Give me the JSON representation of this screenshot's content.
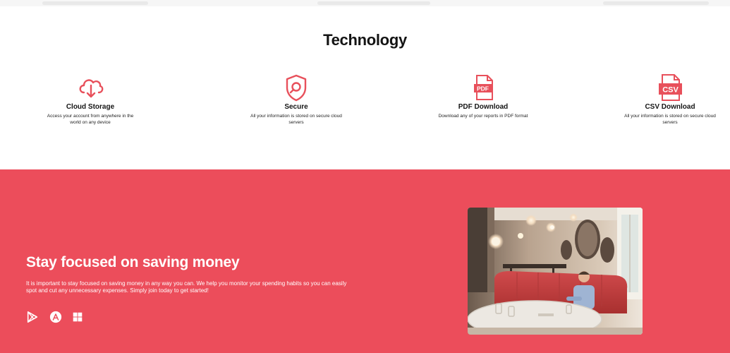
{
  "technology": {
    "title": "Technology",
    "features": [
      {
        "icon": "cloud-download-icon",
        "title": "Cloud Storage",
        "description": "Access your account from anywhere in the world on any device"
      },
      {
        "icon": "shield-lock-icon",
        "title": "Secure",
        "description": "All your information is stored on secure cloud servers"
      },
      {
        "icon": "pdf-file-icon",
        "title": "PDF Download",
        "description": "Download any of your reports in PDF format"
      },
      {
        "icon": "csv-file-icon",
        "title": "CSV Download",
        "description": "All your information is stored on secure cloud servers"
      }
    ]
  },
  "promo": {
    "heading": "Stay focused on saving money",
    "text": "It is important to stay focused on saving money in any way you can. We help you monitor your spending habits so you can easily spot and cut any unnecessary expenses. Simply join today to get started!",
    "store_icons": [
      "google-play-icon",
      "app-store-icon",
      "windows-store-icon"
    ]
  },
  "colors": {
    "accent": "#ec4d5b",
    "icon": "#e8505b",
    "text": "#141414"
  }
}
